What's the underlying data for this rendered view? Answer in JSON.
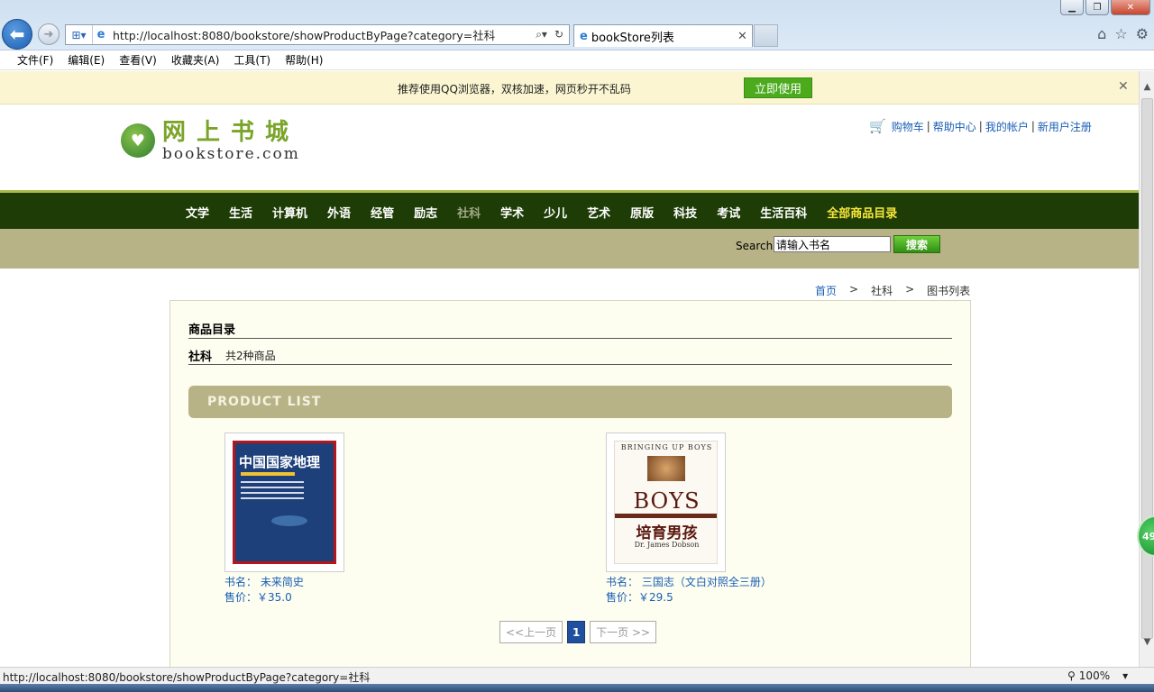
{
  "browser": {
    "url": "http://localhost:8080/bookstore/showProductByPage?category=社科",
    "tab_title": "bookStore列表",
    "menu": [
      "文件(F)",
      "编辑(E)",
      "查看(V)",
      "收藏夹(A)",
      "工具(T)",
      "帮助(H)"
    ],
    "status_url": "http://localhost:8080/bookstore/showProductByPage?category=社科",
    "zoom": "100%"
  },
  "notification": {
    "text": "推荐使用QQ浏览器，双核加速，网页秒开不乱码",
    "action": "立即使用"
  },
  "site": {
    "logo_cn": "网上书城",
    "logo_en": "bookstore.com",
    "top_links": [
      "购物车",
      "帮助中心",
      "我的帐户",
      "新用户注册"
    ],
    "nav": [
      "文学",
      "生活",
      "计算机",
      "外语",
      "经管",
      "励志",
      "社科",
      "学术",
      "少儿",
      "艺术",
      "原版",
      "科技",
      "考试",
      "生活百科",
      "全部商品目录"
    ],
    "nav_active": "社科",
    "search_label": "Search",
    "search_value": "请输入书名",
    "search_button": "搜索"
  },
  "breadcrumb": [
    "首页",
    ">",
    "社科",
    ">",
    "图书列表"
  ],
  "catalog": {
    "title": "商品目录",
    "category": "社科",
    "count_text": "共2种商品",
    "list_header": "PRODUCT LIST"
  },
  "products": [
    {
      "name": "书名： 未来简史",
      "price": "售价：￥35.0",
      "cover_title": "中国国家地理"
    },
    {
      "name": "书名： 三国志（文白对照全三册）",
      "price": "售价：￥29.5",
      "cover_top": "BRINGING UP BOYS",
      "cover_big": "BOYS",
      "cover_cn": "培育男孩",
      "cover_author": "Dr. James Dobson"
    }
  ],
  "pager": {
    "prev": "<<上一页",
    "current": "1",
    "next": "下一页 >>"
  },
  "float_badge": "49"
}
